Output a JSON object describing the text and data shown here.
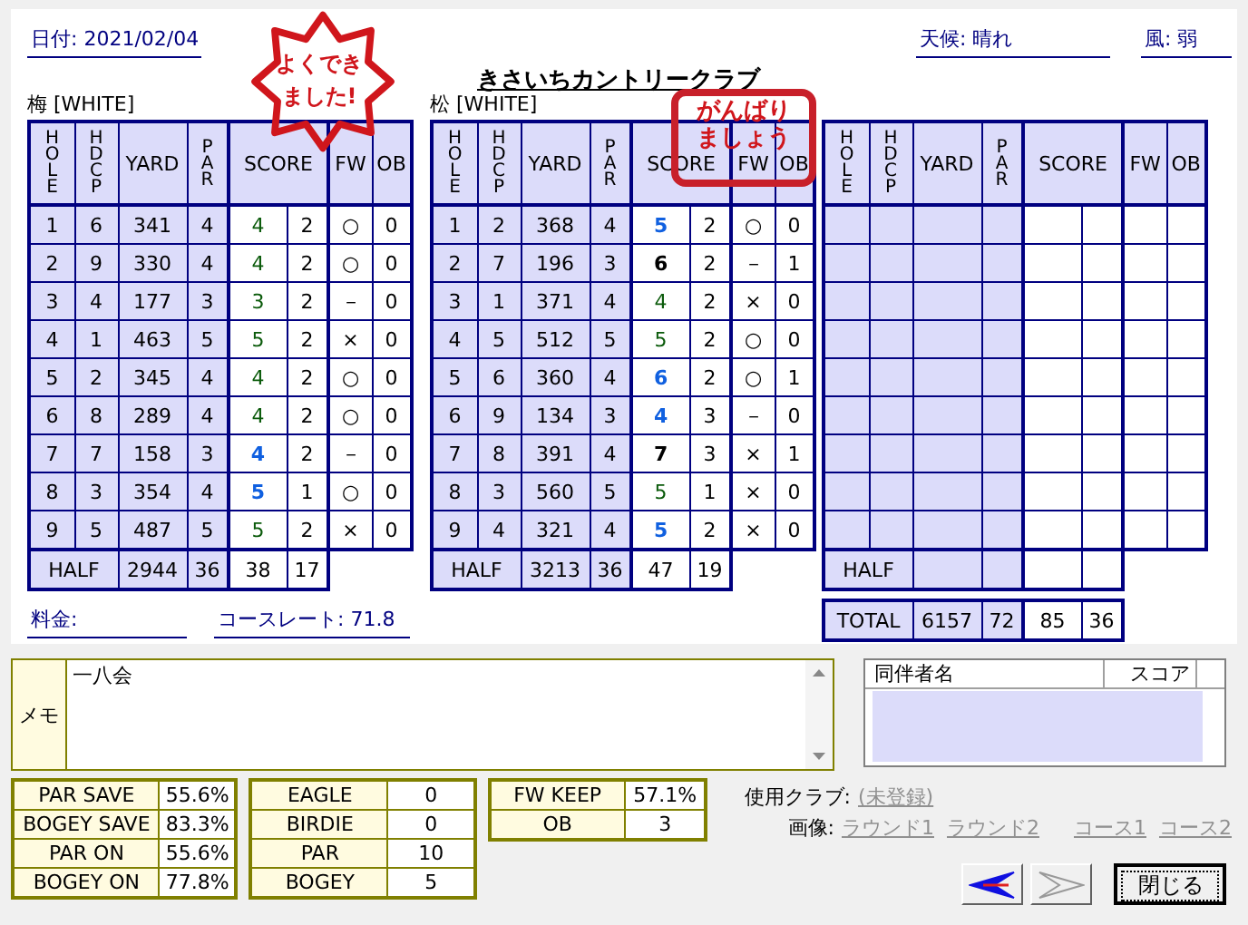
{
  "header": {
    "date_label": "日付:",
    "date": "2021/02/04",
    "course_name": "きさいちカントリークラブ",
    "weather_label": "天候:",
    "weather": "晴れ",
    "wind_label": "風:",
    "wind": "弱"
  },
  "rounds": [
    {
      "title": "梅 [WHITE]",
      "columns": [
        {
          "label": "HOLE",
          "kind": "vertical"
        },
        {
          "label": "HDCP",
          "kind": "vertical"
        },
        {
          "label": "YARD",
          "kind": "plain"
        },
        {
          "label": "PAR",
          "kind": "vertical"
        },
        {
          "label": "SCORE",
          "kind": "score"
        },
        {
          "label": "FW",
          "kind": "plain"
        },
        {
          "label": "OB",
          "kind": "plain"
        }
      ],
      "holes": [
        {
          "hole": "1",
          "hdcp": "6",
          "yard": "341",
          "par": "4",
          "score": "4",
          "color": "#0a5a0a",
          "bold": false,
          "putts": "2",
          "fw": "○",
          "ob": "0"
        },
        {
          "hole": "2",
          "hdcp": "9",
          "yard": "330",
          "par": "4",
          "score": "4",
          "color": "#0a5a0a",
          "bold": false,
          "putts": "2",
          "fw": "○",
          "ob": "0"
        },
        {
          "hole": "3",
          "hdcp": "4",
          "yard": "177",
          "par": "3",
          "score": "3",
          "color": "#0a5a0a",
          "bold": false,
          "putts": "2",
          "fw": "－",
          "ob": "0"
        },
        {
          "hole": "4",
          "hdcp": "1",
          "yard": "463",
          "par": "5",
          "score": "5",
          "color": "#0a5a0a",
          "bold": false,
          "putts": "2",
          "fw": "×",
          "ob": "0"
        },
        {
          "hole": "5",
          "hdcp": "2",
          "yard": "345",
          "par": "4",
          "score": "4",
          "color": "#0a5a0a",
          "bold": false,
          "putts": "2",
          "fw": "○",
          "ob": "0"
        },
        {
          "hole": "6",
          "hdcp": "8",
          "yard": "289",
          "par": "4",
          "score": "4",
          "color": "#0a5a0a",
          "bold": false,
          "putts": "2",
          "fw": "○",
          "ob": "0"
        },
        {
          "hole": "7",
          "hdcp": "7",
          "yard": "158",
          "par": "3",
          "score": "4",
          "color": "#1060e0",
          "bold": true,
          "putts": "2",
          "fw": "－",
          "ob": "0"
        },
        {
          "hole": "8",
          "hdcp": "3",
          "yard": "354",
          "par": "4",
          "score": "5",
          "color": "#1060e0",
          "bold": true,
          "putts": "1",
          "fw": "○",
          "ob": "0"
        },
        {
          "hole": "9",
          "hdcp": "5",
          "yard": "487",
          "par": "5",
          "score": "5",
          "color": "#0a5a0a",
          "bold": false,
          "putts": "2",
          "fw": "×",
          "ob": "0"
        }
      ],
      "half": {
        "label": "HALF",
        "yard": "2944",
        "par": "36",
        "score": "38",
        "putts": "17"
      }
    },
    {
      "title": "松 [WHITE]",
      "columns": [
        {
          "label": "HOLE",
          "kind": "vertical"
        },
        {
          "label": "HDCP",
          "kind": "vertical"
        },
        {
          "label": "YARD",
          "kind": "plain"
        },
        {
          "label": "PAR",
          "kind": "vertical"
        },
        {
          "label": "SCORE",
          "kind": "score"
        },
        {
          "label": "FW",
          "kind": "plain"
        },
        {
          "label": "OB",
          "kind": "plain"
        }
      ],
      "holes": [
        {
          "hole": "1",
          "hdcp": "2",
          "yard": "368",
          "par": "4",
          "score": "5",
          "color": "#1060e0",
          "bold": true,
          "putts": "2",
          "fw": "○",
          "ob": "0"
        },
        {
          "hole": "2",
          "hdcp": "7",
          "yard": "196",
          "par": "3",
          "score": "6",
          "color": "#000000",
          "bold": true,
          "putts": "2",
          "fw": "－",
          "ob": "1"
        },
        {
          "hole": "3",
          "hdcp": "1",
          "yard": "371",
          "par": "4",
          "score": "4",
          "color": "#0a5a0a",
          "bold": false,
          "putts": "2",
          "fw": "×",
          "ob": "0"
        },
        {
          "hole": "4",
          "hdcp": "5",
          "yard": "512",
          "par": "5",
          "score": "5",
          "color": "#0a5a0a",
          "bold": false,
          "putts": "2",
          "fw": "○",
          "ob": "0"
        },
        {
          "hole": "5",
          "hdcp": "6",
          "yard": "360",
          "par": "4",
          "score": "6",
          "color": "#1060e0",
          "bold": true,
          "putts": "2",
          "fw": "○",
          "ob": "1"
        },
        {
          "hole": "6",
          "hdcp": "9",
          "yard": "134",
          "par": "3",
          "score": "4",
          "color": "#1060e0",
          "bold": true,
          "putts": "3",
          "fw": "－",
          "ob": "0"
        },
        {
          "hole": "7",
          "hdcp": "8",
          "yard": "391",
          "par": "4",
          "score": "7",
          "color": "#000000",
          "bold": true,
          "putts": "3",
          "fw": "×",
          "ob": "1"
        },
        {
          "hole": "8",
          "hdcp": "3",
          "yard": "560",
          "par": "5",
          "score": "5",
          "color": "#0a5a0a",
          "bold": false,
          "putts": "1",
          "fw": "×",
          "ob": "0"
        },
        {
          "hole": "9",
          "hdcp": "4",
          "yard": "321",
          "par": "4",
          "score": "5",
          "color": "#1060e0",
          "bold": true,
          "putts": "2",
          "fw": "×",
          "ob": "0"
        }
      ],
      "half": {
        "label": "HALF",
        "yard": "3213",
        "par": "36",
        "score": "47",
        "putts": "19"
      }
    },
    {
      "columns": [
        {
          "label": "HOLE",
          "kind": "vertical"
        },
        {
          "label": "HDCP",
          "kind": "vertical"
        },
        {
          "label": "YARD",
          "kind": "plain"
        },
        {
          "label": "PAR",
          "kind": "vertical"
        },
        {
          "label": "SCORE",
          "kind": "score"
        },
        {
          "label": "FW",
          "kind": "plain"
        },
        {
          "label": "OB",
          "kind": "plain"
        }
      ],
      "half": {
        "label": "HALF"
      }
    }
  ],
  "total": {
    "label": "TOTAL",
    "yard": "6157",
    "par": "72",
    "score": "85",
    "putts": "36"
  },
  "fee_label": "料金:",
  "course_rate_label": "コースレート:",
  "course_rate": "71.8",
  "stamps": [
    {
      "kind": "blossom",
      "lines": [
        "よくでき",
        "ました!"
      ]
    },
    {
      "kind": "box",
      "lines": [
        "がんばり",
        "ましょう"
      ]
    }
  ],
  "memo": {
    "label": "メモ",
    "text": "一八会"
  },
  "companions": {
    "columns": [
      "同伴者名",
      "スコア"
    ]
  },
  "stats": [
    [
      {
        "label": "PAR SAVE",
        "value": "55.6%"
      },
      {
        "label": "BOGEY SAVE",
        "value": "83.3%"
      },
      {
        "label": "PAR ON",
        "value": "55.6%"
      },
      {
        "label": "BOGEY ON",
        "value": "77.8%"
      }
    ],
    [
      {
        "label": "EAGLE",
        "value": "0"
      },
      {
        "label": "BIRDIE",
        "value": "0"
      },
      {
        "label": "PAR",
        "value": "10"
      },
      {
        "label": "BOGEY",
        "value": "5"
      }
    ],
    [
      {
        "label": "FW KEEP",
        "value": "57.1%"
      },
      {
        "label": "OB",
        "value": "3"
      }
    ]
  ],
  "clubs_label": "使用クラブ:",
  "clubs_link": "(未登録)",
  "images_label": "画像:",
  "image_links": [
    "ラウンド1",
    "ラウンド2",
    "コース1",
    "コース2"
  ],
  "buttons": {
    "prev": {
      "disabled": false
    },
    "next": {
      "disabled": true
    },
    "close": {
      "label": "閉じる"
    }
  }
}
